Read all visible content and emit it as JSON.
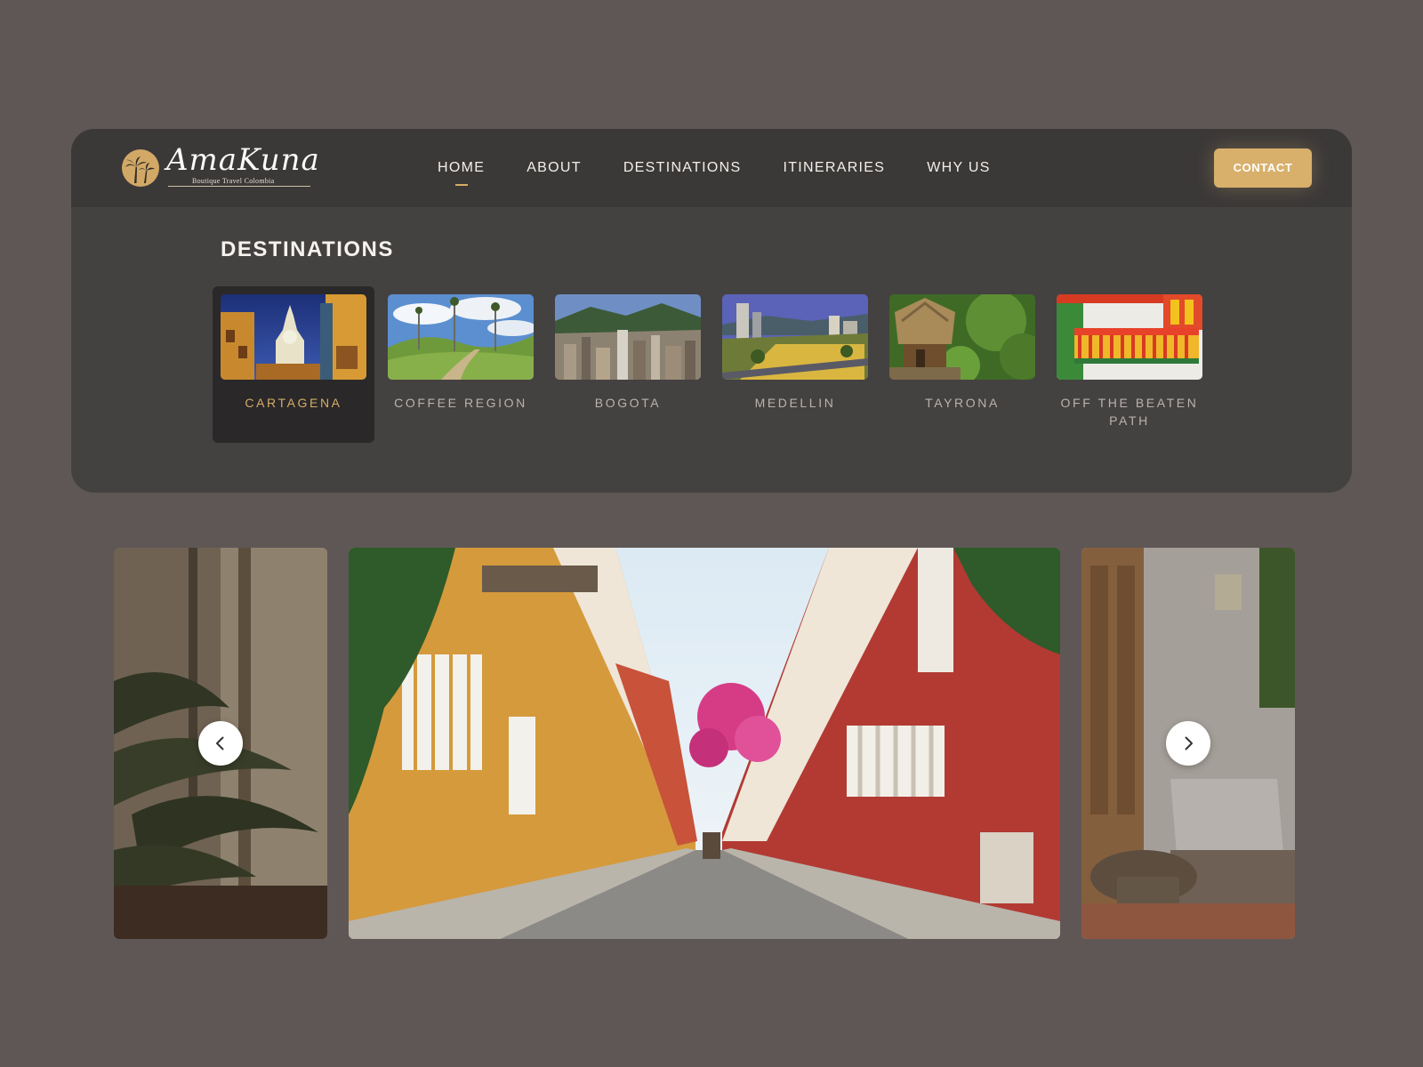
{
  "brand": {
    "name": "AmaKuna",
    "tagline": "Boutique Travel Colombia",
    "accent": "#d8b06c",
    "background": "#5f5755",
    "panel": "#444141"
  },
  "nav": {
    "items": [
      {
        "label": "HOME",
        "active": true
      },
      {
        "label": "ABOUT"
      },
      {
        "label": "DESTINATIONS"
      },
      {
        "label": "ITINERARIES"
      },
      {
        "label": "WHY US"
      }
    ],
    "contact_label": "CONTACT"
  },
  "destinations": {
    "title": "DESTINATIONS",
    "items": [
      {
        "label": "CARTAGENA",
        "active": true
      },
      {
        "label": "COFFEE REGION"
      },
      {
        "label": "BOGOTA"
      },
      {
        "label": "MEDELLIN"
      },
      {
        "label": "TAYRONA"
      },
      {
        "label": "OFF THE BEATEN PATH"
      }
    ]
  },
  "carousel": {
    "prev_icon": "chevron-left-icon",
    "next_icon": "chevron-right-icon"
  }
}
